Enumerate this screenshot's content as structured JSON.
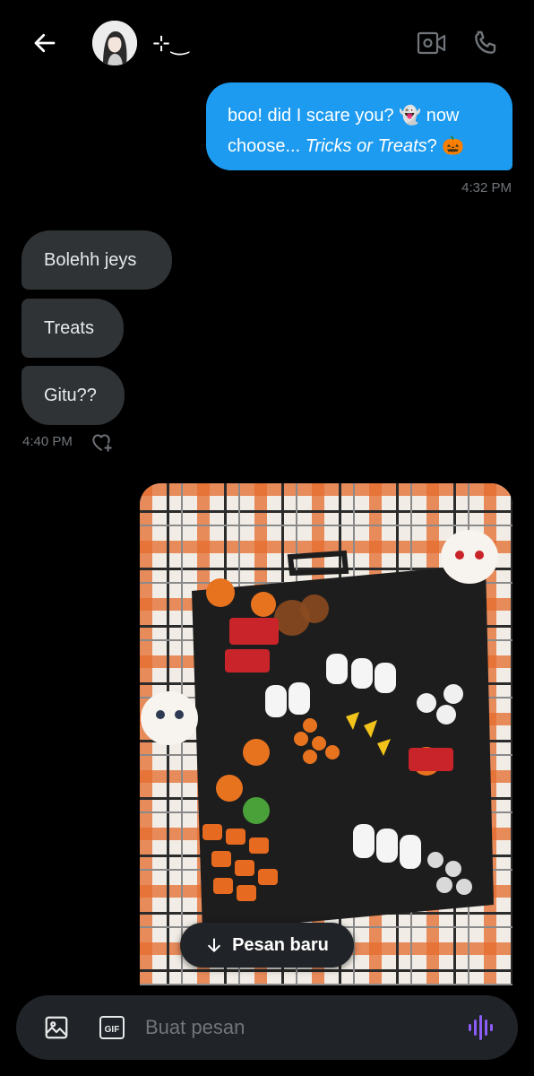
{
  "header": {
    "contact_name": "⊹‿",
    "icons": {
      "back": "arrow-left-icon",
      "video": "video-camera-icon",
      "call": "phone-icon"
    }
  },
  "messages": {
    "outgoing": {
      "text_part1": "boo! did I scare you? 👻 now choose... ",
      "text_italic": "Tricks or Treats",
      "text_part2": "? 🎃",
      "time": "4:32 PM"
    },
    "incoming": [
      {
        "text": "Bolehh jeys"
      },
      {
        "text": "Treats"
      },
      {
        "text": "Gitu??"
      }
    ],
    "incoming_time": "4:40 PM",
    "reaction_icon": "heart-plus-icon"
  },
  "photo": {
    "description_icon": "image-attachment"
  },
  "new_messages_button": {
    "label": "Pesan baru",
    "icon": "arrow-down-icon"
  },
  "composer": {
    "placeholder": "Buat pesan",
    "gif_label": "GIF",
    "icons": {
      "image": "image-icon",
      "gif": "gif-icon",
      "voice": "voice-wave-icon"
    }
  },
  "colors": {
    "background": "#000000",
    "outgoing_bubble": "#1d9bf0",
    "incoming_bubble": "#2f3336",
    "timestamp": "#71767b",
    "composer_bg": "#202327",
    "voice_accent": "#8b5cf6"
  }
}
